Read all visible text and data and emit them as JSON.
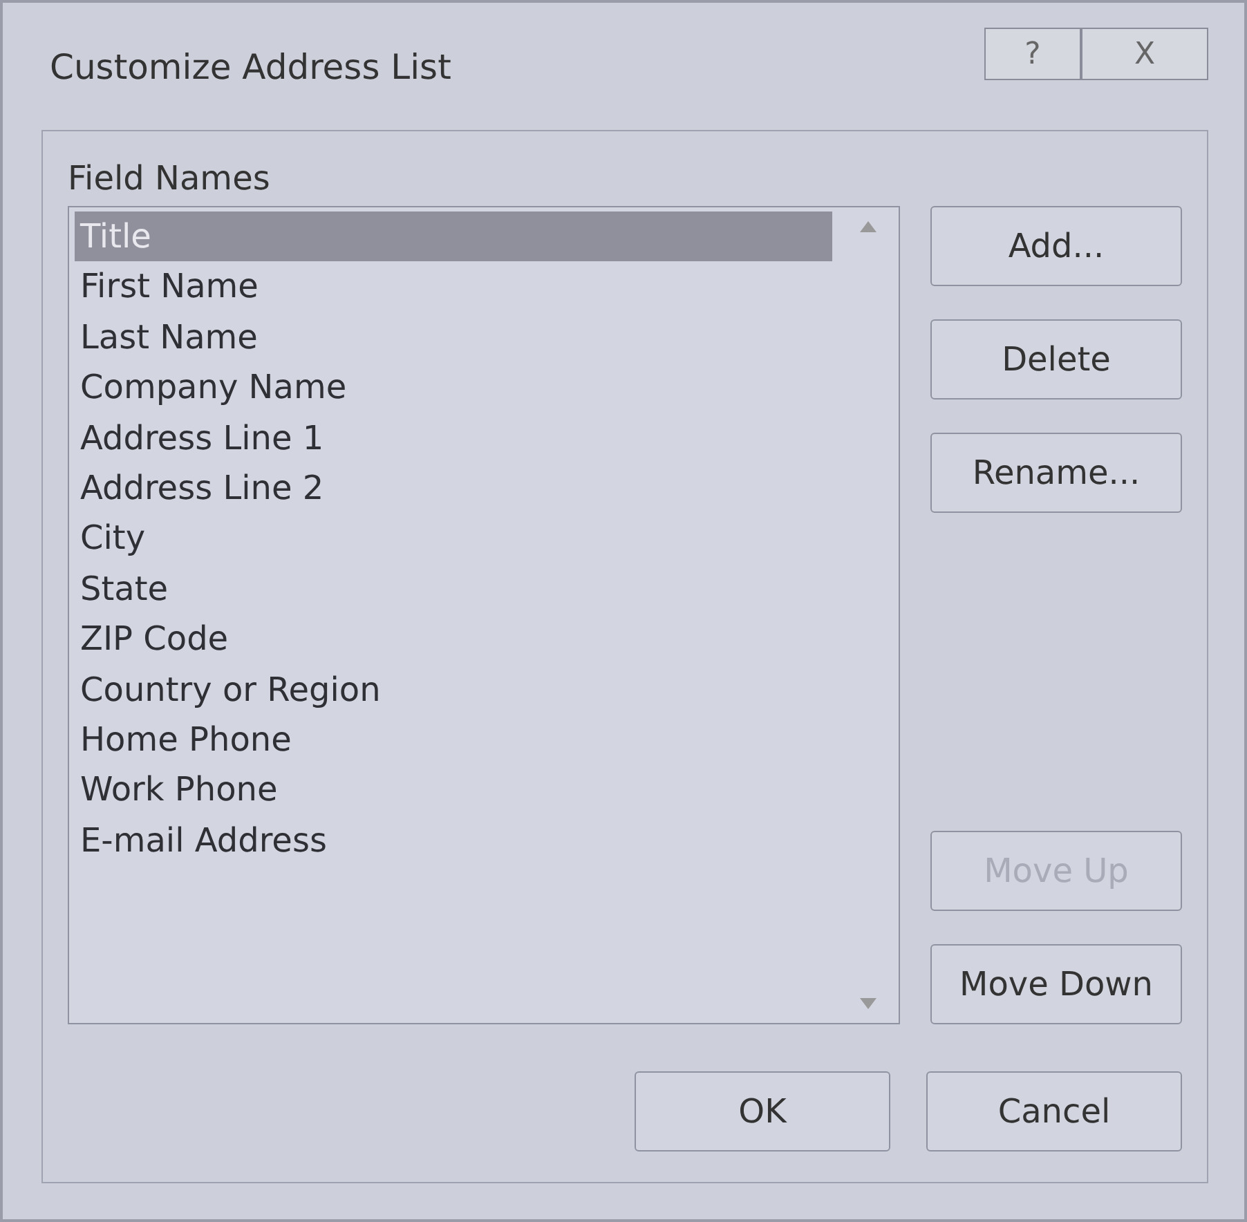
{
  "window": {
    "title": "Customize Address List",
    "help_button": "?",
    "close_button": "X"
  },
  "field_names": {
    "label": "Field Names",
    "items": [
      {
        "text": "Title",
        "selected": true
      },
      {
        "text": "First Name",
        "selected": false
      },
      {
        "text": "Last Name",
        "selected": false
      },
      {
        "text": "Company Name",
        "selected": false
      },
      {
        "text": "Address Line 1",
        "selected": false
      },
      {
        "text": "Address Line 2",
        "selected": false
      },
      {
        "text": "City",
        "selected": false
      },
      {
        "text": "State",
        "selected": false
      },
      {
        "text": "ZIP Code",
        "selected": false
      },
      {
        "text": "Country or Region",
        "selected": false
      },
      {
        "text": "Home Phone",
        "selected": false
      },
      {
        "text": "Work Phone",
        "selected": false
      },
      {
        "text": "E-mail Address",
        "selected": false
      }
    ]
  },
  "side_buttons": [
    {
      "label": "Add...",
      "disabled": false
    },
    {
      "label": "Delete",
      "disabled": false
    },
    {
      "label": "Rename...",
      "disabled": false
    }
  ],
  "move_buttons": [
    {
      "label": "Move Up",
      "disabled": true
    },
    {
      "label": "Move Down",
      "disabled": false
    }
  ],
  "buttons": [
    "OK",
    "Cancel"
  ]
}
